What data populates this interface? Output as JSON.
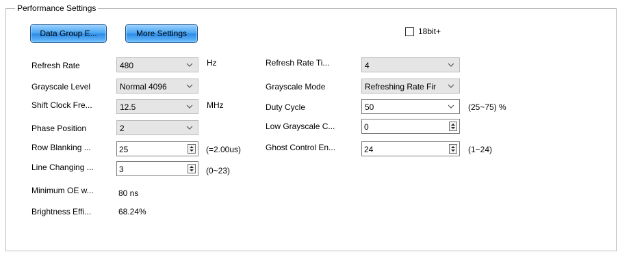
{
  "group_title": "Performance Settings",
  "buttons": {
    "data_group": "Data Group E...",
    "more_settings": "More Settings"
  },
  "checkbox_18bit": {
    "label": "18bit+",
    "checked": false
  },
  "left": {
    "refresh_rate": {
      "label": "Refresh Rate",
      "value": "480",
      "unit": "Hz"
    },
    "grayscale_level": {
      "label": "Grayscale Level",
      "value": "Normal 4096"
    },
    "shift_clock": {
      "label": "Shift Clock Fre...",
      "value": "12.5",
      "unit": "MHz"
    },
    "phase_position": {
      "label": "Phase Position",
      "value": "2"
    },
    "row_blanking": {
      "label": "Row Blanking ...",
      "value": "25",
      "note": "(=2.00us)"
    },
    "line_changing": {
      "label": "Line Changing ...",
      "value": "3",
      "note": "(0~23)"
    },
    "minimum_oe": {
      "label": "Minimum OE w...",
      "value": "80 ns"
    },
    "brightness": {
      "label": "Brightness Effi...",
      "value": "68.24%"
    }
  },
  "right": {
    "refresh_rate_times": {
      "label": "Refresh Rate Ti...",
      "value": "4"
    },
    "grayscale_mode": {
      "label": "Grayscale Mode",
      "value": "Refreshing Rate Fir"
    },
    "duty_cycle": {
      "label": "Duty Cycle",
      "value": "50",
      "note": "(25~75) %"
    },
    "low_grayscale": {
      "label": "Low Grayscale C...",
      "value": "0"
    },
    "ghost_control": {
      "label": "Ghost Control En...",
      "value": "24",
      "note": "(1~24)"
    }
  },
  "icons": {
    "dropdown": "chevron-down-icon",
    "spinner": "spinner-arrows-icon"
  }
}
